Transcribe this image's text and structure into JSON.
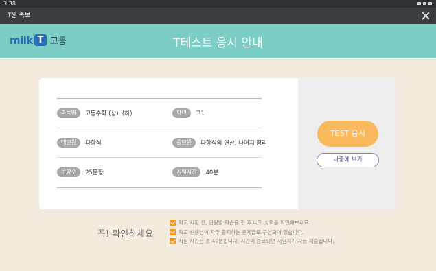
{
  "status_bar": {
    "time": "3:38"
  },
  "titlebar": {
    "title": "T쌤 족보"
  },
  "header": {
    "logo_milk": "milk",
    "logo_t": "T",
    "logo_grade": "고등",
    "title": "T테스트 응시 안내"
  },
  "info": {
    "rows": [
      {
        "left_tag": "과목명",
        "left_value": "고등수학 (상), (하)",
        "right_tag": "학년",
        "right_value": "고1"
      },
      {
        "left_tag": "대단원",
        "left_value": "다항식",
        "right_tag": "중단원",
        "right_value": "다항식의 연산, 나머지 정리"
      },
      {
        "left_tag": "문항수",
        "left_value": "25문항",
        "right_tag": "시험시간",
        "right_value": "40분"
      }
    ]
  },
  "actions": {
    "test_button": "TEST 응시",
    "later_button": "나중에 보기"
  },
  "notice": {
    "title": "꼭! 확인하세요",
    "items": [
      "학교 시험 전, 단원별 학습을 한 후 나의 실력을 확인해보세요.",
      "학교 선생님이 자주 출제하는 문제들로 구성되어 있습니다.",
      "시험 시간은 총 40분입니다. 시간이 종료되면 시험지가 자동 제출됩니다."
    ]
  },
  "colors": {
    "header_bg": "#7ccdc4",
    "page_bg": "#f3ebdd",
    "accent_orange": "#fbb95d",
    "check_orange": "#f39a1e",
    "later_border": "#8a7bb8"
  }
}
